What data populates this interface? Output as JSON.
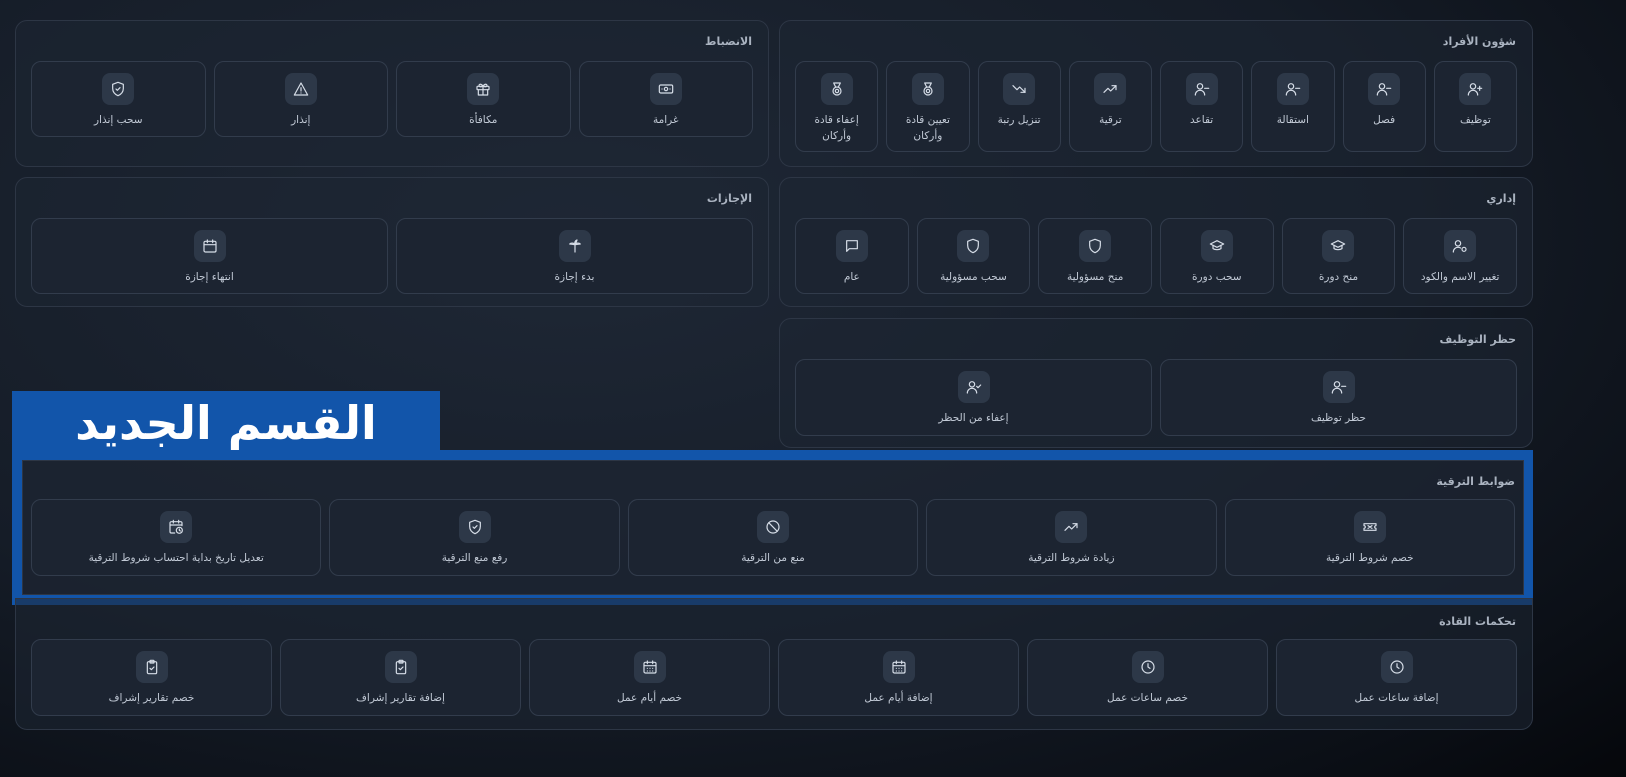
{
  "banner": {
    "text": "القسم الجديد",
    "color": "#1255aa"
  },
  "sections": {
    "personnel": {
      "title": "شؤون الأفراد",
      "items": [
        {
          "label": "توظيف",
          "icon": "user-plus-icon"
        },
        {
          "label": "فصل",
          "icon": "user-minus-icon"
        },
        {
          "label": "استقالة",
          "icon": "user-minus-icon"
        },
        {
          "label": "تقاعد",
          "icon": "user-minus-icon"
        },
        {
          "label": "ترقية",
          "icon": "trending-up-icon"
        },
        {
          "label": "تنزيل رتبة",
          "icon": "trending-down-icon"
        },
        {
          "label": "تعيين قادة وأركان",
          "icon": "medal-icon"
        },
        {
          "label": "إعفاء قادة وأركان",
          "icon": "medal-icon"
        }
      ]
    },
    "discipline": {
      "title": "الانضباط",
      "items": [
        {
          "label": "غرامة",
          "icon": "banknote-icon"
        },
        {
          "label": "مكافأة",
          "icon": "gift-icon"
        },
        {
          "label": "إنذار",
          "icon": "alert-triangle-icon"
        },
        {
          "label": "سحب إنذار",
          "icon": "shield-check-icon"
        }
      ]
    },
    "admin": {
      "title": "إداري",
      "items": [
        {
          "label": "تغيير الاسم والكود",
          "icon": "user-cog-icon"
        },
        {
          "label": "منح دورة",
          "icon": "graduation-cap-icon"
        },
        {
          "label": "سحب دورة",
          "icon": "graduation-cap-icon"
        },
        {
          "label": "منح مسؤولية",
          "icon": "shield-icon"
        },
        {
          "label": "سحب مسؤولية",
          "icon": "shield-icon"
        },
        {
          "label": "عام",
          "icon": "message-square-icon"
        }
      ]
    },
    "leaves": {
      "title": "الإجازات",
      "items": [
        {
          "label": "بدء إجازة",
          "icon": "palm-tree-icon"
        },
        {
          "label": "انتهاء إجازة",
          "icon": "calendar-icon"
        }
      ]
    },
    "ban": {
      "title": "حظر التوظيف",
      "items": [
        {
          "label": "حظر توظيف",
          "icon": "user-minus-icon"
        },
        {
          "label": "إعفاء من الحظر",
          "icon": "user-check-icon"
        }
      ]
    },
    "promotion": {
      "title": "ضوابط الترقية",
      "items": [
        {
          "label": "خصم شروط الترقية",
          "icon": "ticket-icon"
        },
        {
          "label": "زيادة شروط الترقية",
          "icon": "trending-up-icon"
        },
        {
          "label": "منع من الترقية",
          "icon": "ban-icon"
        },
        {
          "label": "رفع منع الترقية",
          "icon": "shield-check-icon"
        },
        {
          "label": "تعديل تاريخ بداية احتساب شروط الترقية",
          "icon": "calendar-clock-icon"
        }
      ]
    },
    "leaders": {
      "title": "تحكمات القادة",
      "items": [
        {
          "label": "إضافة ساعات عمل",
          "icon": "clock-icon"
        },
        {
          "label": "خصم ساعات عمل",
          "icon": "clock-icon"
        },
        {
          "label": "إضافة أيام عمل",
          "icon": "calendar-days-icon"
        },
        {
          "label": "خصم أيام عمل",
          "icon": "calendar-days-icon"
        },
        {
          "label": "إضافة تقارير إشراف",
          "icon": "clipboard-check-icon"
        },
        {
          "label": "خصم تقارير إشراف",
          "icon": "clipboard-check-icon"
        }
      ]
    }
  }
}
